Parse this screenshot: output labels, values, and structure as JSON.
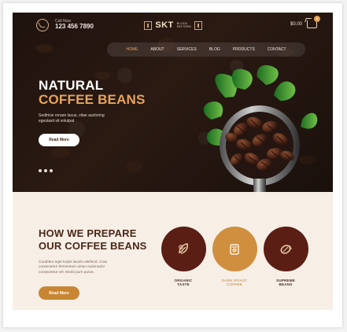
{
  "colors": {
    "brown": "#5a1e14",
    "gold": "#c88635",
    "cream": "#f7efe6",
    "darkbg": "#24150f"
  },
  "header": {
    "call_label": "Call Now",
    "phone": "123 456 7890",
    "logo_main": "SKT",
    "logo_sub_1": "BLOCK",
    "logo_sub_2": "PATTERN",
    "cart_price": "$0.00",
    "cart_count": "0"
  },
  "nav": {
    "items": [
      "HOME",
      "ABOUT",
      "SERVICES",
      "BLOG",
      "PRODUCTS",
      "CONTACT"
    ]
  },
  "hero": {
    "headline_1": "NATURAL",
    "headline_2": "COFFEE BEANS",
    "description_line_1": "Sedtricie ornare lacus, vitae auctoring",
    "description_line_2": "egestasit sit volutpat",
    "button": "Read More"
  },
  "about": {
    "title_1": "HOW WE PREPARE",
    "title_2": "OUR COFFEE BEANS",
    "text_line_1": "Curabitur eget turpis iaculis eleifend. Cras",
    "text_line_2": "consectetur fermentum antun euismodor",
    "text_line_3": "consectetur vel. Morbi purn purus.",
    "button": "Read More"
  },
  "features": [
    {
      "line_1": "ORGANIC",
      "line_2": "TASTE",
      "icon": "leaf-icon"
    },
    {
      "line_1": "DARK ROAST",
      "line_2": "COFFEE",
      "icon": "coffee-bag-icon"
    },
    {
      "line_1": "SUPREME",
      "line_2": "BEANS",
      "icon": "bean-icon"
    }
  ]
}
